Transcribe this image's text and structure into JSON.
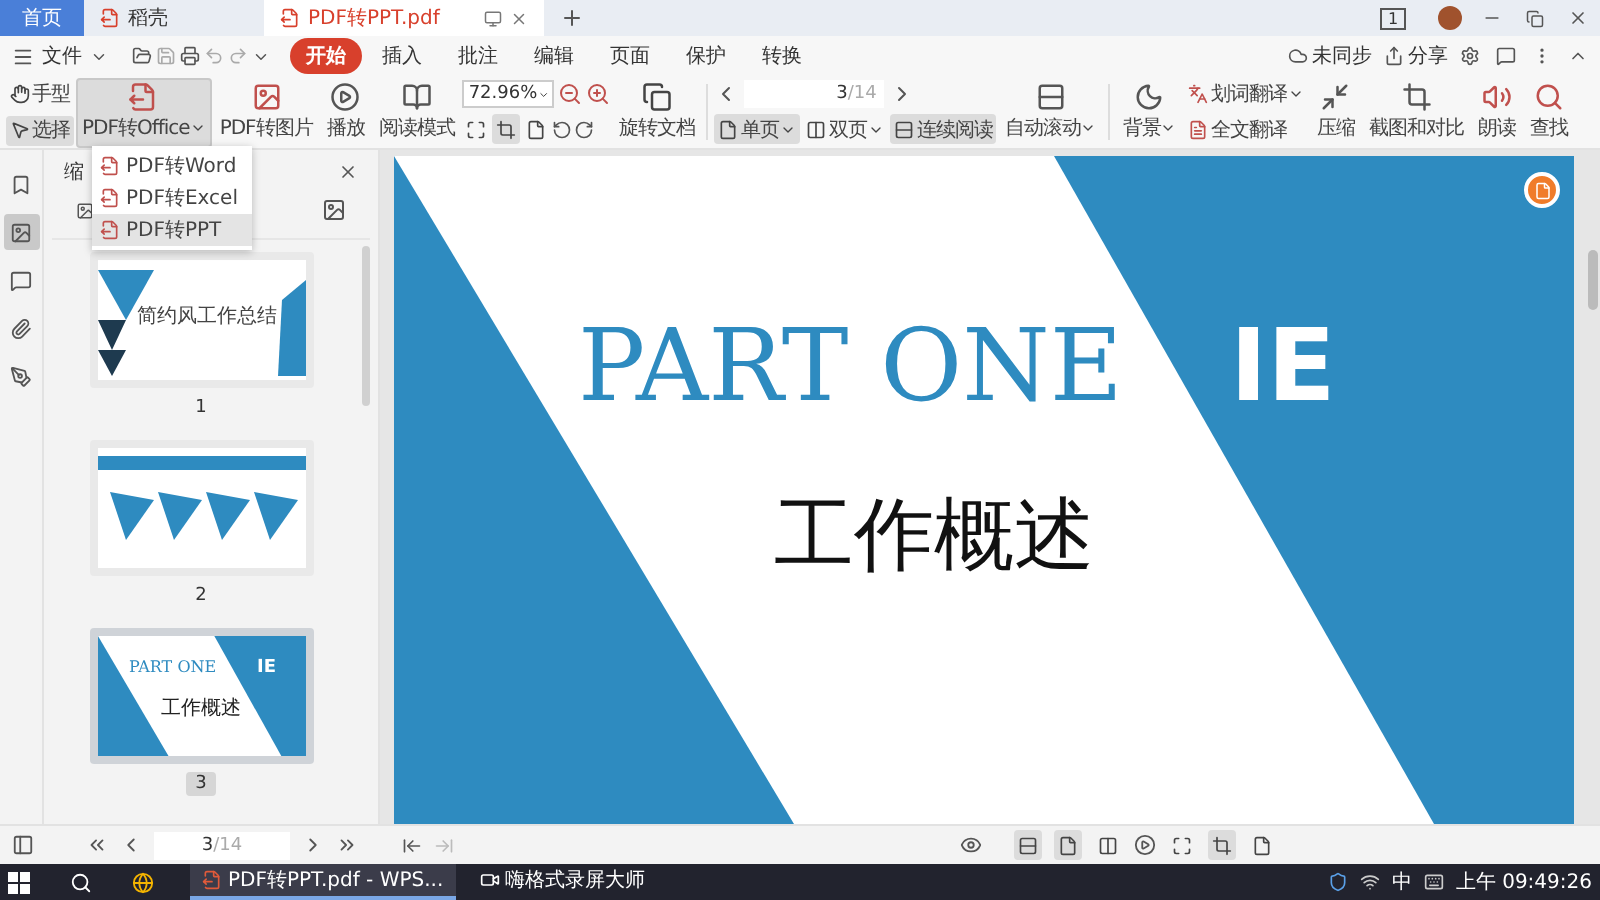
{
  "tabs": [
    {
      "kind": "home",
      "label": "首页",
      "selected": false
    },
    {
      "kind": "app",
      "label": "稻壳",
      "selected": false
    },
    {
      "kind": "doc",
      "label": "PDF转PPT.pdf",
      "selected": true
    }
  ],
  "window": {
    "badge": "1"
  },
  "menu": {
    "file": "文件",
    "tabs": [
      {
        "label": "开始",
        "selected": true
      },
      {
        "label": "插入",
        "selected": false
      },
      {
        "label": "批注",
        "selected": false
      },
      {
        "label": "编辑",
        "selected": false
      },
      {
        "label": "页面",
        "selected": false
      },
      {
        "label": "保护",
        "selected": false
      },
      {
        "label": "转换",
        "selected": false
      }
    ],
    "right": [
      "未同步",
      "分享"
    ]
  },
  "toolbar": {
    "hand_tools": [
      {
        "label": "手型",
        "selected": false
      },
      {
        "label": "选择",
        "selected": true
      }
    ],
    "big_buttons": [
      {
        "label": "PDF转Office",
        "dropdown": true,
        "selected": true
      },
      {
        "label": "PDF转图片",
        "dropdown": false,
        "selected": false
      },
      {
        "label": "播放",
        "dropdown": false,
        "selected": false
      },
      {
        "label": "阅读模式",
        "dropdown": false,
        "selected": false
      }
    ],
    "zoom": {
      "value": "72.96%"
    },
    "fit_modes": [
      {
        "selected": false
      },
      {
        "selected": true
      },
      {
        "selected": false
      }
    ],
    "rotate": "旋转文档",
    "page_nav": {
      "current": "3",
      "total": "/14"
    },
    "view_modes": [
      {
        "label": "单页",
        "dropdown": true,
        "selected": true
      },
      {
        "label": "双页",
        "dropdown": true,
        "selected": false
      },
      {
        "label": "连续阅读",
        "dropdown": false,
        "selected": true
      }
    ],
    "tools": [
      {
        "kind": "large",
        "label": "自动滚动",
        "dropdown": true
      },
      {
        "kind": "large",
        "label": "背景",
        "dropdown": true
      },
      {
        "kind": "small",
        "label": "划词翻译",
        "dropdown": true
      },
      {
        "kind": "small",
        "label": "全文翻译",
        "dropdown": false
      },
      {
        "kind": "large",
        "label": "压缩",
        "dropdown": false
      },
      {
        "kind": "large",
        "label": "截图和对比",
        "dropdown": false
      },
      {
        "kind": "large",
        "label": "朗读",
        "dropdown": false
      },
      {
        "kind": "large",
        "label": "查找",
        "dropdown": false
      }
    ]
  },
  "dropdown_menu": [
    {
      "label": "PDF转Word",
      "selected": false
    },
    {
      "label": "PDF转Excel",
      "selected": false
    },
    {
      "label": "PDF转PPT",
      "selected": true
    }
  ],
  "sidebar": {
    "rail": [
      {
        "selected": false
      },
      {
        "selected": true
      },
      {
        "selected": false
      },
      {
        "selected": false
      },
      {
        "selected": false
      }
    ],
    "title": "缩",
    "thumbnails": [
      {
        "kind": "cover",
        "number": "1",
        "selected": false,
        "texts": [
          "简约风工作总结"
        ]
      },
      {
        "kind": "contents",
        "number": "2",
        "selected": false
      },
      {
        "kind": "section",
        "number": "3",
        "selected": true,
        "texts": [
          "PART ONE",
          "IE",
          "工作概述"
        ]
      }
    ]
  },
  "slide": {
    "title": "PART ONE",
    "title_overlay": "IE",
    "subtitle": "工作概述"
  },
  "status_bar": {
    "current": "3",
    "total": "/14",
    "view_modes": [
      {
        "selected": true
      },
      {
        "selected": true
      },
      {
        "selected": false
      }
    ],
    "fit_modes": [
      {
        "selected": false
      },
      {
        "selected": true
      },
      {
        "selected": false
      }
    ]
  },
  "taskbar": {
    "apps": [
      {
        "label": "PDF转PPT.pdf - WPS...",
        "selected": true
      },
      {
        "label": "嗨格式录屏大师",
        "selected": false
      }
    ],
    "ime": "中",
    "clock": "上午 09:49:26"
  }
}
